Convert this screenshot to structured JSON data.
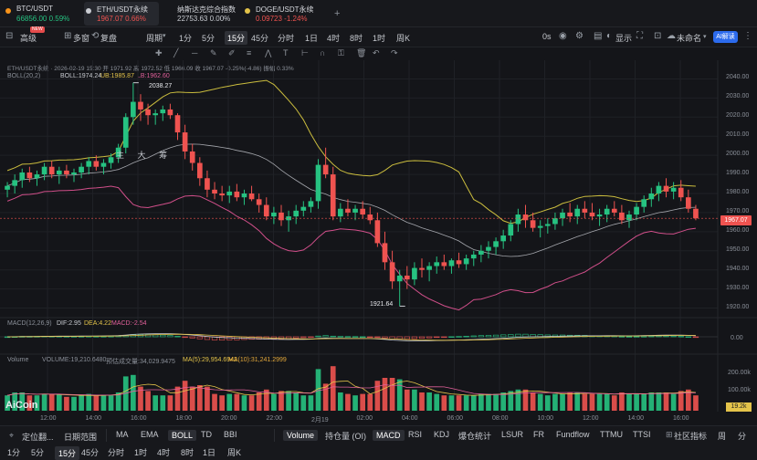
{
  "tabs": [
    {
      "name": "BTC/USDT",
      "price": "66856.00",
      "change": "0.59%",
      "dir": "up",
      "dot": "#f7931a",
      "active": false
    },
    {
      "name": "ETH/USDT永续",
      "price": "1967.07",
      "change": "0.66%",
      "dir": "down",
      "dot": "#c9ccd2",
      "active": true
    },
    {
      "name": "纳斯达克综合指数",
      "price": "22753.63",
      "change": "0.00%",
      "dir": "none",
      "dot": "",
      "active": false
    },
    {
      "name": "DOGE/USDT永续",
      "price": "0.09723",
      "change": "-1.24%",
      "dir": "down",
      "dot": "#e3c34a",
      "active": false
    }
  ],
  "toolbar": {
    "advanced": "高级",
    "multi": "多窗",
    "replay": "复盘",
    "period": "周期",
    "intervals": [
      "1分",
      "5分",
      "15分",
      "45分",
      "分时",
      "1日",
      "4时",
      "8时",
      "1时",
      "周K"
    ],
    "active_interval": "15分",
    "new_badge": "NEW",
    "countdown": "0s",
    "display": "显示",
    "unnamed": "未命名",
    "ai": "AI解读"
  },
  "legend": {
    "symbol_line": "ETH/USDT永续 · 2026-02-19 15:30  开 1971.92  高 1972.52  低 1966.09  收 1967.07  -0.25%(-4.86)  振幅 0.33%",
    "boll_name": "BOLL(20,2)",
    "boll_mid": "BOLL:1974.24",
    "boll_ub": "UB:1985.87",
    "boll_lb": "LB:1962.60",
    "macd_name": "MACD(12,26,9)",
    "macd_dif": "DIF:2.95",
    "macd_dea": "DEA:4.22",
    "macd_val": "MACD:-2.54",
    "vol_name": "Volume",
    "vol_val": "VOLUME:19,210.6480",
    "vol_est": "预估成交量:34,029.9475",
    "vol_ma5": "MA(5):29,954.6942",
    "vol_ma10": "MA(10):31,241.2999"
  },
  "float_buttons": [
    "主",
    "大",
    "筹"
  ],
  "annotations": {
    "high": "2038.27",
    "low": "1921.64"
  },
  "y_ticks": [
    "2040.00",
    "2030.00",
    "2020.00",
    "2010.00",
    "2000.00",
    "1990.00",
    "1980.00",
    "1970.00",
    "1960.00",
    "1950.00",
    "1940.00",
    "1930.00",
    "1920.00"
  ],
  "macd_ticks": [
    "0.00"
  ],
  "vol_ticks": [
    "200.00k",
    "100.00k"
  ],
  "current_price": "1967.07",
  "current_vol": "19.2k",
  "x_ticks": [
    "12:00",
    "14:00",
    "16:00",
    "18:00",
    "20:00",
    "22:00",
    "2月19",
    "02:00",
    "04:00",
    "06:00",
    "08:00",
    "10:00",
    "12:00",
    "14:00",
    "16:00"
  ],
  "logo": "AiCoin",
  "bottom": {
    "left": [
      "定位翻...",
      "日期范围"
    ],
    "indicators": [
      "MA",
      "EMA",
      "BOLL",
      "TD",
      "BBI"
    ],
    "active_indicator": "BOLL",
    "sub_indicators": [
      "Volume",
      "持仓量 (OI)",
      "MACD",
      "RSI",
      "KDJ",
      "爆仓统计",
      "LSUR",
      "FR",
      "Fundflow",
      "TTMU",
      "TTSI",
      "社区指标"
    ],
    "active_subs": [
      "Volume",
      "MACD"
    ],
    "intervals": [
      "1分",
      "5分",
      "15分",
      "45分",
      "分时",
      "1时",
      "4时",
      "8时",
      "1日",
      "周K"
    ],
    "active_interval": "15分",
    "right": [
      "周",
      "分"
    ]
  },
  "chart_data": {
    "type": "candlestick",
    "ylim": [
      1915,
      2045
    ],
    "candles_note": "OHLC approximated from screenshot, 15m bars",
    "ohlc": [
      [
        1982,
        1986,
        1978,
        1984
      ],
      [
        1984,
        1990,
        1980,
        1987
      ],
      [
        1987,
        1993,
        1983,
        1991
      ],
      [
        1991,
        1994,
        1986,
        1988
      ],
      [
        1988,
        1992,
        1984,
        1990
      ],
      [
        1990,
        1996,
        1987,
        1994
      ],
      [
        1994,
        1997,
        1988,
        1990
      ],
      [
        1990,
        1994,
        1985,
        1992
      ],
      [
        1992,
        1995,
        1988,
        1990
      ],
      [
        1990,
        1993,
        1986,
        1991
      ],
      [
        1991,
        1996,
        1988,
        1994
      ],
      [
        1994,
        1999,
        1990,
        1997
      ],
      [
        1997,
        2000,
        1992,
        1994
      ],
      [
        1994,
        1998,
        1990,
        1996
      ],
      [
        1996,
        2001,
        1993,
        1999
      ],
      [
        1999,
        2006,
        1996,
        2004
      ],
      [
        2004,
        2022,
        2001,
        2020
      ],
      [
        2020,
        2038,
        2016,
        2028
      ],
      [
        2028,
        2032,
        2018,
        2024
      ],
      [
        2024,
        2027,
        2016,
        2021
      ],
      [
        2021,
        2024,
        2016,
        2022
      ],
      [
        2022,
        2026,
        2018,
        2024
      ],
      [
        2024,
        2027,
        2019,
        2021
      ],
      [
        2021,
        2022,
        2008,
        2012
      ],
      [
        2012,
        2016,
        1998,
        2002
      ],
      [
        2002,
        2006,
        1992,
        1996
      ],
      [
        1996,
        1999,
        1984,
        1988
      ],
      [
        1988,
        1992,
        1978,
        1982
      ],
      [
        1982,
        1986,
        1977,
        1980
      ],
      [
        1980,
        1984,
        1976,
        1979
      ],
      [
        1979,
        1984,
        1975,
        1981
      ],
      [
        1981,
        1985,
        1976,
        1978
      ],
      [
        1978,
        1982,
        1974,
        1980
      ],
      [
        1980,
        1984,
        1976,
        1977
      ],
      [
        1977,
        1980,
        1970,
        1974
      ],
      [
        1974,
        1978,
        1966,
        1968
      ],
      [
        1968,
        1973,
        1964,
        1970
      ],
      [
        1970,
        1974,
        1963,
        1966
      ],
      [
        1966,
        1971,
        1960,
        1968
      ],
      [
        1968,
        1974,
        1964,
        1971
      ],
      [
        1971,
        1976,
        1968,
        1973
      ],
      [
        1973,
        1978,
        1970,
        1976
      ],
      [
        1976,
        1998,
        1972,
        1995
      ],
      [
        1995,
        2004,
        1988,
        1990
      ],
      [
        1990,
        1994,
        1966,
        1968
      ],
      [
        1968,
        1975,
        1965,
        1972
      ],
      [
        1972,
        1977,
        1968,
        1970
      ],
      [
        1970,
        1974,
        1966,
        1972
      ],
      [
        1972,
        1976,
        1967,
        1969
      ],
      [
        1969,
        1973,
        1964,
        1966
      ],
      [
        1966,
        1970,
        1952,
        1954
      ],
      [
        1954,
        1960,
        1940,
        1944
      ],
      [
        1944,
        1950,
        1930,
        1934
      ],
      [
        1934,
        1940,
        1921,
        1937
      ],
      [
        1937,
        1942,
        1930,
        1935
      ],
      [
        1935,
        1944,
        1932,
        1941
      ],
      [
        1941,
        1946,
        1936,
        1940
      ],
      [
        1940,
        1944,
        1934,
        1942
      ],
      [
        1942,
        1947,
        1938,
        1944
      ],
      [
        1944,
        1948,
        1940,
        1942
      ],
      [
        1942,
        1946,
        1938,
        1945
      ],
      [
        1945,
        1949,
        1941,
        1943
      ],
      [
        1943,
        1948,
        1940,
        1946
      ],
      [
        1946,
        1950,
        1942,
        1948
      ],
      [
        1948,
        1953,
        1944,
        1950
      ],
      [
        1950,
        1955,
        1946,
        1952
      ],
      [
        1952,
        1957,
        1948,
        1955
      ],
      [
        1955,
        1961,
        1951,
        1958
      ],
      [
        1958,
        1966,
        1955,
        1964
      ],
      [
        1964,
        1972,
        1960,
        1969
      ],
      [
        1969,
        1974,
        1962,
        1966
      ],
      [
        1966,
        1970,
        1960,
        1962
      ],
      [
        1962,
        1966,
        1957,
        1963
      ],
      [
        1963,
        1967,
        1959,
        1964
      ],
      [
        1964,
        1970,
        1961,
        1967
      ],
      [
        1967,
        1972,
        1963,
        1970
      ],
      [
        1970,
        1975,
        1965,
        1968
      ],
      [
        1968,
        1974,
        1964,
        1972
      ],
      [
        1972,
        1976,
        1967,
        1970
      ],
      [
        1970,
        1975,
        1966,
        1968
      ],
      [
        1968,
        1972,
        1963,
        1969
      ],
      [
        1969,
        1974,
        1965,
        1972
      ],
      [
        1972,
        1976,
        1968,
        1970
      ],
      [
        1970,
        1974,
        1964,
        1966
      ],
      [
        1966,
        1971,
        1962,
        1969
      ],
      [
        1969,
        1975,
        1966,
        1973
      ],
      [
        1973,
        1979,
        1970,
        1977
      ],
      [
        1977,
        1983,
        1973,
        1980
      ],
      [
        1980,
        1986,
        1976,
        1984
      ],
      [
        1984,
        1988,
        1978,
        1981
      ],
      [
        1981,
        1986,
        1977,
        1983
      ],
      [
        1983,
        1987,
        1976,
        1978
      ],
      [
        1978,
        1982,
        1970,
        1972
      ],
      [
        1972,
        1974,
        1966,
        1967
      ]
    ]
  },
  "colors": {
    "up": "#26c281",
    "down": "#ef5350",
    "boll_ub": "#cbbd3e",
    "boll_mid": "#c9ccd2",
    "boll_lb": "#d14f8a",
    "macd_dif": "#e3c34a",
    "macd_dea": "#e0609a",
    "bg": "#141519",
    "grid": "#1f2126"
  }
}
